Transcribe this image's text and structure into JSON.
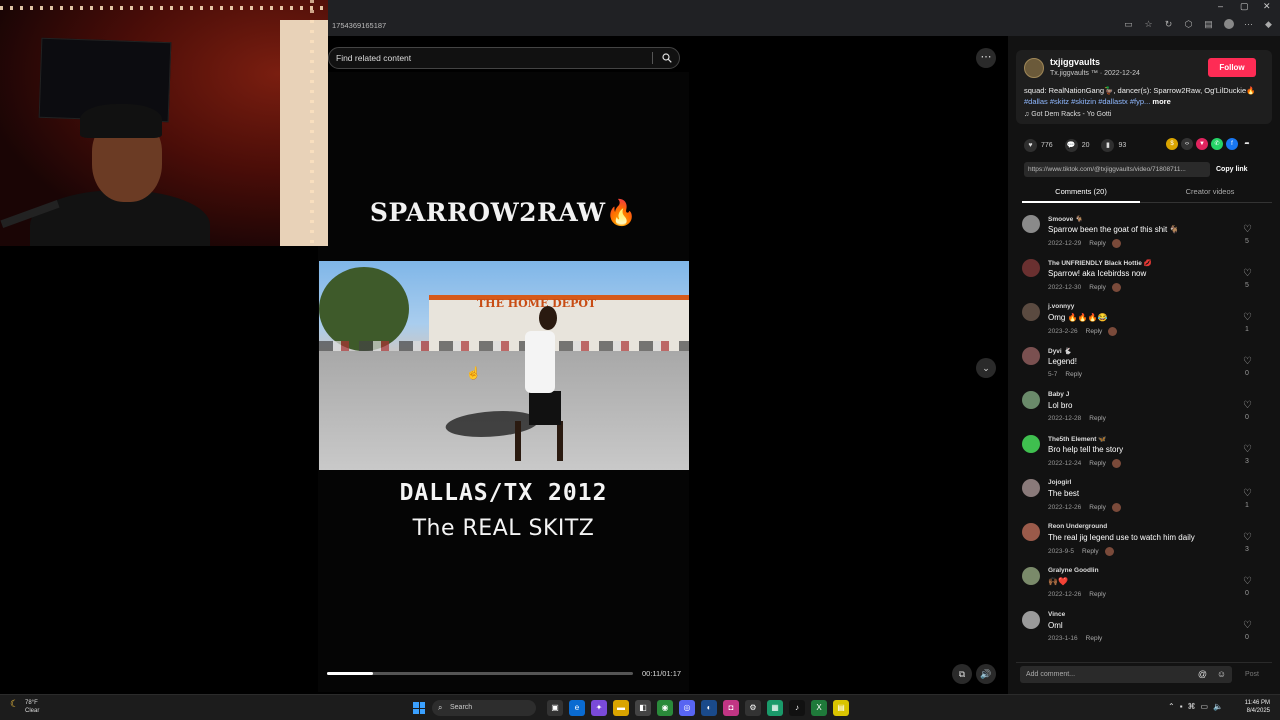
{
  "browser": {
    "url": "1754369165187",
    "window_controls": [
      "–",
      "▢",
      "✕"
    ]
  },
  "search": {
    "placeholder": "Find related content"
  },
  "video": {
    "title_text": "SPARROW2RAW🔥",
    "clip_sign": "THE HOME DEPOT",
    "location_year": "DALLAS/TX 2012",
    "subtitle": "The REAL SKITZ",
    "time": "00:11/01:17",
    "progress": 0.15
  },
  "author": {
    "username": "txjiggvaults",
    "display_name": "Tx.jiggvaults ™",
    "date": "· 2022-12-24",
    "follow_label": "Follow",
    "description_prefix": "squad: RealNationGang🦆, dancer(s): Sparrow2Raw, Og'LilDuckie🔥",
    "hashtags": "#dallas #skitz #skitzin #dallastx #fyp...",
    "more_label": "more",
    "music": "Got Dem Racks - Yo Gotti"
  },
  "stats": {
    "likes": "776",
    "comments": "20",
    "saves": "93"
  },
  "share": {
    "link": "https://www.tiktok.com/@txjiggvaults/video/71808711...",
    "copy_label": "Copy link"
  },
  "tabs": {
    "comments": "Comments (20)",
    "creator_videos": "Creator videos"
  },
  "comments": [
    {
      "user": "Smoove 🐐",
      "text": "Sparrow been the goat of this shit 🐐",
      "date": "2022-12-29",
      "likes": "5",
      "badge": true,
      "color": "#8a8a8a"
    },
    {
      "user": "The UNFRIENDLY Black Hottie 💋",
      "text": "Sparrow! aka Icebirdss now",
      "date": "2022-12-30",
      "likes": "5",
      "badge": true,
      "color": "#6a3030"
    },
    {
      "user": "j.vonnyy",
      "text": "Omg 🔥🔥🔥😂",
      "date": "2023-2-26",
      "likes": "1",
      "badge": true,
      "color": "#5a4a40"
    },
    {
      "user": "Dyvi 🐇",
      "text": "Legend!",
      "date": "5-7",
      "likes": "0",
      "badge": false,
      "color": "#7a5050"
    },
    {
      "user": "Baby J",
      "text": "Lol bro",
      "date": "2022-12-28",
      "likes": "0",
      "badge": false,
      "color": "#6a8a6a"
    },
    {
      "user": "The5th Element 🦋",
      "text": "Bro help tell the story",
      "date": "2022-12-24",
      "likes": "3",
      "badge": true,
      "color": "#3fbf4f"
    },
    {
      "user": "Jojogirl",
      "text": "The best",
      "date": "2022-12-26",
      "likes": "1",
      "badge": true,
      "color": "#8a7a7a"
    },
    {
      "user": "Reon Underground",
      "text": "The real jig legend use to watch him daily",
      "date": "2023-9-5",
      "likes": "3",
      "badge": true,
      "color": "#9a5a4a"
    },
    {
      "user": "Gralyne Goodlin",
      "text": "🙌🏾❤️",
      "date": "2022-12-26",
      "likes": "0",
      "badge": false,
      "color": "#7a8a6a"
    },
    {
      "user": "Vince",
      "text": "Oml",
      "date": "2023-1-16",
      "likes": "0",
      "badge": false,
      "color": "#9a9a9a"
    }
  ],
  "comment_ui": {
    "reply_label": "Reply",
    "add_placeholder": "Add comment...",
    "post_label": "Post"
  },
  "taskbar": {
    "temperature": "78°F",
    "condition": "Clear",
    "search_label": "Search",
    "time": "11:46 PM",
    "date": "8/4/2025"
  },
  "colors": {
    "accent": "#fe2c55",
    "panel": "#121212",
    "taskbar": "#1c1c1c"
  }
}
